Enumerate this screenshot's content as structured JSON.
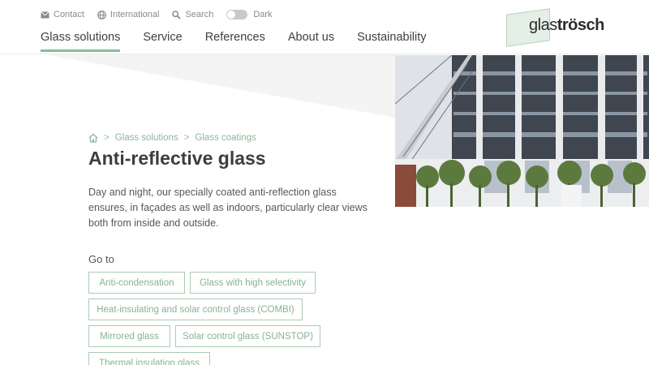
{
  "topbar": {
    "contact": "Contact",
    "international": "International",
    "search": "Search",
    "dark": "Dark"
  },
  "nav": {
    "items": [
      {
        "label": "Glass solutions",
        "active": true
      },
      {
        "label": "Service"
      },
      {
        "label": "References"
      },
      {
        "label": "About us"
      },
      {
        "label": "Sustainability"
      }
    ]
  },
  "logo": {
    "part1": "glas",
    "part2": "trösch"
  },
  "breadcrumb": {
    "items": [
      "Glass solutions",
      "Glass coatings"
    ],
    "separator": ">"
  },
  "page": {
    "title": "Anti-reflective glass",
    "intro": "Day and night, our specially coated anti-reflection glass ensures, in façades as well as indoors, particularly clear views both from inside and outside."
  },
  "goto": {
    "label": "Go to",
    "links": [
      "Anti-condensation",
      "Glass with high selectivity",
      "Heat-insulating and solar control glass (COMBI)",
      "Mirrored glass",
      "Solar control glass (SUNSTOP)",
      "Thermal insulation glass"
    ]
  },
  "colors": {
    "accent": "#8cb89a",
    "chip_border": "#a9ccb3",
    "text": "#3d3d3d"
  }
}
